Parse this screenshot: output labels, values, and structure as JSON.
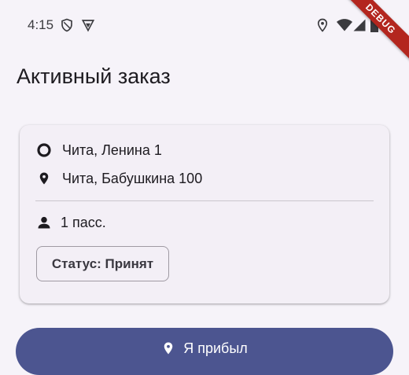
{
  "status_bar": {
    "time": "4:15",
    "debug_banner": "DEBUG"
  },
  "page": {
    "title": "Активный заказ"
  },
  "order_card": {
    "pickup_address": "Чита, Ленина 1",
    "dropoff_address": "Чита, Бабушкина 100",
    "passengers": "1 пасс.",
    "status_chip": "Статус: Принят"
  },
  "actions": {
    "arrive_button_label": "Я прибыл"
  },
  "colors": {
    "background": "#f6f3f9",
    "card": "#f3eff6",
    "primary_button": "#4c5590",
    "debug_ribbon": "#b3261e"
  },
  "icons": {
    "pickup": "circle-outline-icon",
    "dropoff": "location-pin-icon",
    "passengers": "person-icon",
    "arrive": "location-pin-icon"
  }
}
